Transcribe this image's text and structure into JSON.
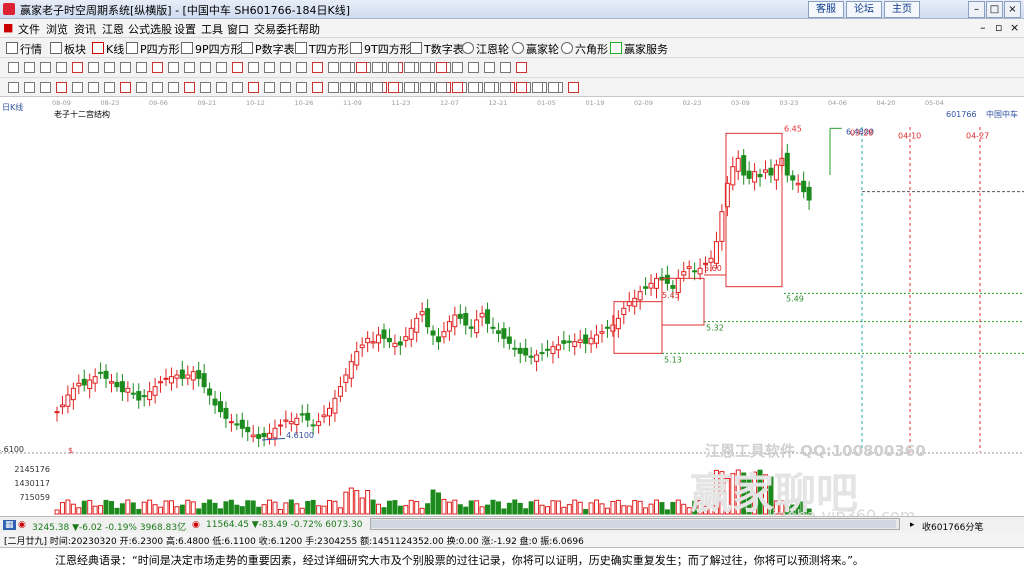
{
  "window": {
    "title": "赢家老子时空周期系统[纵横版] - [中国中车  SH601766-184日K线]",
    "top_buttons": [
      "客服",
      "论坛",
      "主页"
    ]
  },
  "menu": [
    "文件",
    "浏览",
    "资讯",
    "江恩",
    "公式选股",
    "设置",
    "工具",
    "窗口",
    "交易委托",
    "帮助"
  ],
  "toolbar": [
    "行情",
    "板块",
    "K线",
    "P四方形",
    "9P四方形",
    "P数字表",
    "T四方形",
    "9T四方形",
    "T数字表",
    "江恩轮",
    "赢家轮",
    "六角形",
    "赢家服务"
  ],
  "chart": {
    "period_label": "日K线",
    "study_name": "老子十二宫结构",
    "stock_code": "601766",
    "stock_name": "中国中车",
    "x_dates": [
      "08-09",
      "08-23",
      "09-06",
      "09-21",
      "10-12",
      "10-26",
      "11-09",
      "11-23",
      "12-07",
      "12-21",
      "01-05",
      "01-19",
      "02-09",
      "02-23",
      "03-09",
      "03-23",
      "04-06",
      "04-20",
      "05-04"
    ],
    "y_volume_labels": [
      "4.6100",
      "2145176",
      "1430117",
      "715059"
    ],
    "annotations": {
      "low": "4.6100",
      "high1": "6.45",
      "high2": "6.4800",
      "p560": "5.60",
      "p545": "5.45",
      "p549": "5.49",
      "p532": "5.32",
      "p513": "5.13",
      "d0328": "03-28",
      "d0410": "04-10",
      "d0427": "04-27",
      "dollar": "$"
    },
    "colors": {
      "up": "#e02020",
      "down": "#1c8a1c",
      "box": "#e03030",
      "green_line": "#2aa02a"
    }
  },
  "watermark": {
    "line1": "江恩工具软件  QQ:100800360",
    "line2": "赢家聊吧",
    "line3": "liaoba.vip360.com"
  },
  "index_bar": {
    "sh": "3245.38  ▼-6.02  -0.19%  3968.83亿",
    "sz": "11564.45  ▼-83.49  -0.72%  6073.30",
    "right": "收601766分笔"
  },
  "info_bar": {
    "text": "[二月廿九] 时间:20230320 开:6.2300 高:6.4800 低:6.1100 收:6.1200 手:2304255 额:1451124352.00 换:0.00 涨:-1.92 盘:0 振:6.0696"
  },
  "quote": {
    "text": "江恩经典语录：“时间是决定市场走势的重要因素，经过详细研究大市及个别股票的过往记录，你将可以证明，历史确实重复发生；而了解过往，你将可以预测将来。”。"
  }
}
